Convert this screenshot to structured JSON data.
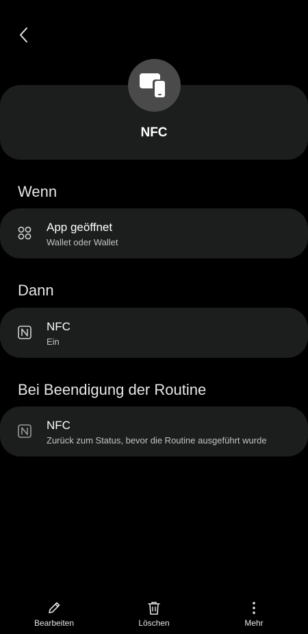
{
  "header": {
    "title": "NFC",
    "icon": "devices-icon"
  },
  "sections": {
    "when": {
      "title": "Wenn",
      "card": {
        "title": "App geöffnet",
        "subtitle": "Wallet oder Wallet",
        "icon": "apps-icon"
      }
    },
    "then": {
      "title": "Dann",
      "card": {
        "title": "NFC",
        "subtitle": "Ein",
        "icon": "nfc-icon"
      }
    },
    "end": {
      "title": "Bei Beendigung der Routine",
      "card": {
        "title": "NFC",
        "subtitle": "Zurück zum Status, bevor die Routine ausgeführt wurde",
        "icon": "nfc-icon"
      }
    }
  },
  "bottom_bar": {
    "edit_label": "Bearbeiten",
    "delete_label": "Löschen",
    "more_label": "Mehr"
  },
  "colors": {
    "background": "#000000",
    "card": "#1b1e1c",
    "icon_circle": "#4a4a4a"
  }
}
